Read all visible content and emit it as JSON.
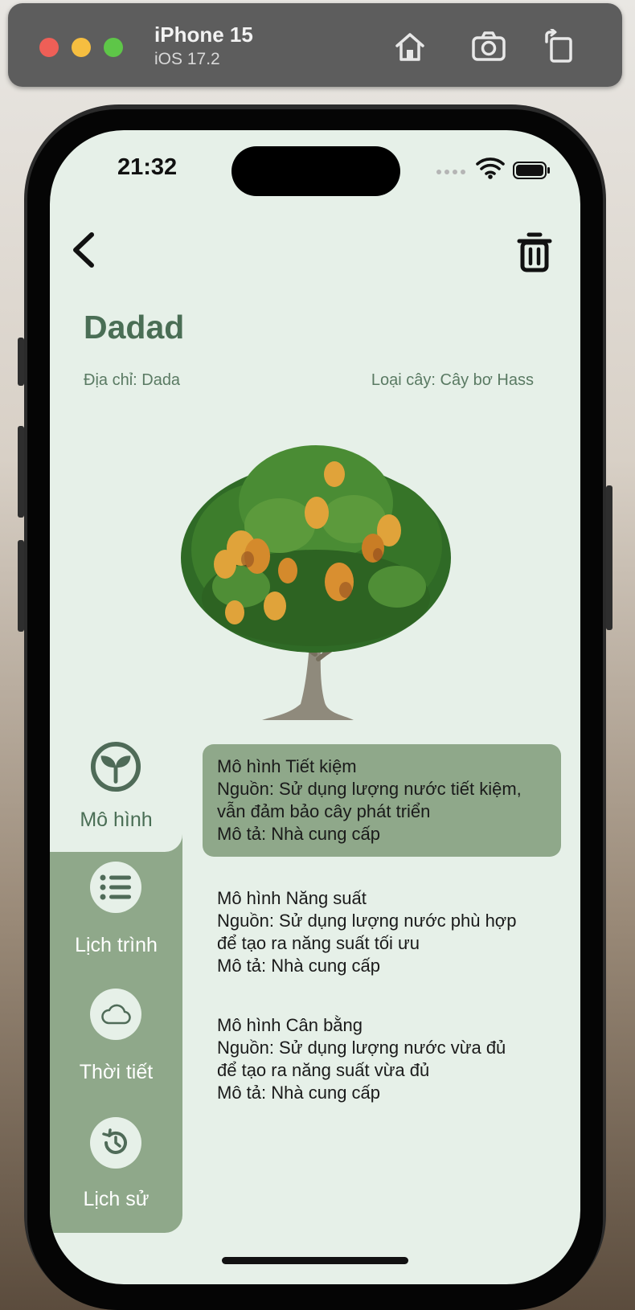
{
  "simulator": {
    "device_name": "iPhone 15",
    "os_version": "iOS 17.2",
    "icons": [
      "home-icon",
      "screenshot-icon",
      "rotate-icon"
    ]
  },
  "status_bar": {
    "time": "21:32"
  },
  "header": {
    "title": "Dadad",
    "address": "Địa chỉ: Dada",
    "plant_type": "Loại cây: Cây bơ Hass"
  },
  "side_nav": {
    "items": [
      {
        "label": "Mô hình",
        "icon": "sprout-icon",
        "active": true
      },
      {
        "label": "Lịch trình",
        "icon": "list-icon",
        "active": false
      },
      {
        "label": "Thời tiết",
        "icon": "cloud-icon",
        "active": false
      },
      {
        "label": "Lịch sử",
        "icon": "history-icon",
        "active": false
      }
    ]
  },
  "models": [
    {
      "title": "Mô hình Tiết kiệm",
      "source_line1": "Nguồn: Sử dụng lượng nước tiết kiệm,",
      "source_line2": "vẫn đảm bảo cây phát triển",
      "description": "Mô tả: Nhà cung cấp",
      "selected": true
    },
    {
      "title": "Mô hình Năng suất",
      "source_line1": "Nguồn: Sử dụng lượng nước phù hợp",
      "source_line2": "để tạo ra năng suất tối ưu",
      "description": "Mô tả: Nhà cung cấp",
      "selected": false
    },
    {
      "title": "Mô hình Cân bằng",
      "source_line1": "Nguồn: Sử dụng lượng nước vừa đủ",
      "source_line2": "để tạo ra năng suất vừa đủ",
      "description": "Mô tả: Nhà cung cấp",
      "selected": false
    }
  ],
  "colors": {
    "screen_bg": "#e6f0e8",
    "accent_green": "#8fa88a",
    "title_green": "#4a6e55",
    "icon_dark_green": "#4f6b58"
  }
}
